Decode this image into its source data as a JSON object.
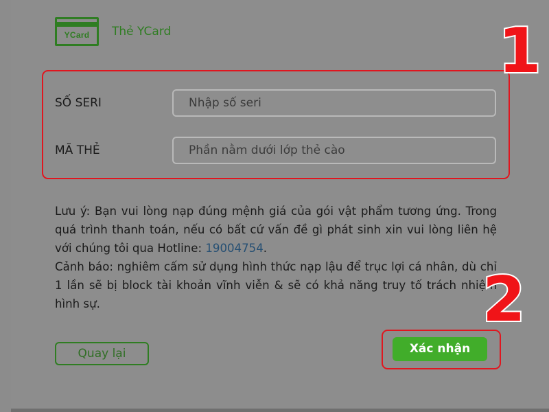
{
  "header": {
    "icon_text": "YCard",
    "title": "Thẻ YCard"
  },
  "form": {
    "serial_label": "SỐ SERI",
    "serial_placeholder": "Nhập số seri",
    "serial_value": "",
    "code_label": "MÃ THẺ",
    "code_placeholder": "Phần nằm dưới lớp thẻ cào",
    "code_value": ""
  },
  "note": {
    "notice_prefix": "Lưu ý: Bạn vui lòng nạp đúng mệnh giá của gói vật phẩm tương ứng. Trong quá trình thanh toán, nếu có bất cứ vấn đề gì phát sinh xin vui lòng liên hệ với chúng tôi qua Hotline: ",
    "hotline": "19004754",
    "notice_suffix": ".",
    "warning": "Cảnh báo: nghiêm cấm sử dụng hình thức nạp lậu để trục lợi cá nhân, dù chỉ 1 lần sẽ bị block tài khoản vĩnh viễn & sẽ có khả năng truy tố trách nhiệm hình sự."
  },
  "buttons": {
    "back_label": "Quay lại",
    "confirm_label": "Xác nhận"
  },
  "annotations": {
    "step_1": "1",
    "step_2": "2"
  },
  "colors": {
    "brand_green": "#2f7d22",
    "confirm_green": "#41ad2a",
    "highlight_red": "#e0161f",
    "hotline_blue": "#254f73"
  }
}
